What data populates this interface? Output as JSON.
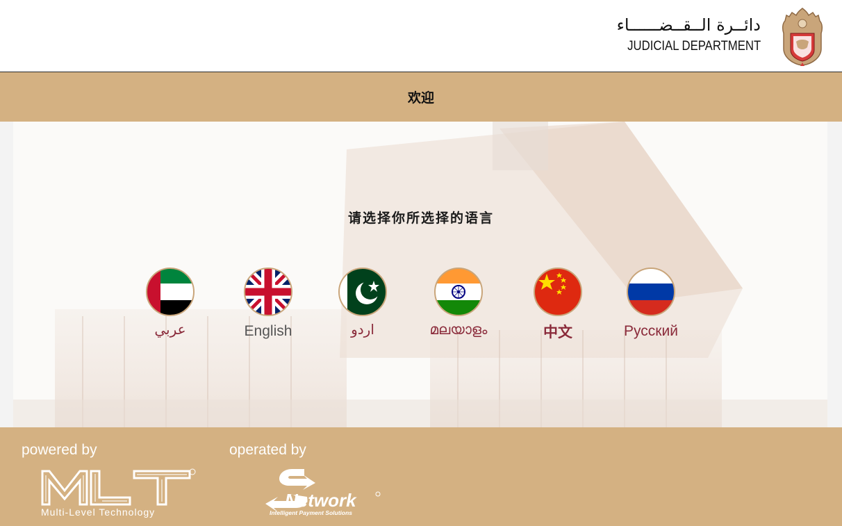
{
  "header": {
    "brand_ar": "دائــرة الــقــضــــــاء",
    "brand_en": "JUDICIAL DEPARTMENT",
    "emblem_icon": "falcon-emblem-icon"
  },
  "welcome": {
    "text": "欢迎"
  },
  "main": {
    "prompt": "请选择你所选择的语言",
    "languages": [
      {
        "label": "عربي",
        "flag": "uae-flag-icon"
      },
      {
        "label": "English",
        "flag": "uk-flag-icon"
      },
      {
        "label": "اردو",
        "flag": "pakistan-flag-icon"
      },
      {
        "label": "മലയാളം",
        "flag": "india-flag-icon"
      },
      {
        "label": "中文",
        "flag": "china-flag-icon"
      },
      {
        "label": "Русский",
        "flag": "russia-flag-icon"
      }
    ]
  },
  "footer": {
    "powered_by": "powered by",
    "operated_by": "operated by",
    "mlt_name": "Multi-Level Technology",
    "network_name": "Network",
    "network_tagline": "Intelligent Payment Solutions"
  },
  "colors": {
    "tan": "#d4b182",
    "label_red": "#8a2a3a"
  }
}
